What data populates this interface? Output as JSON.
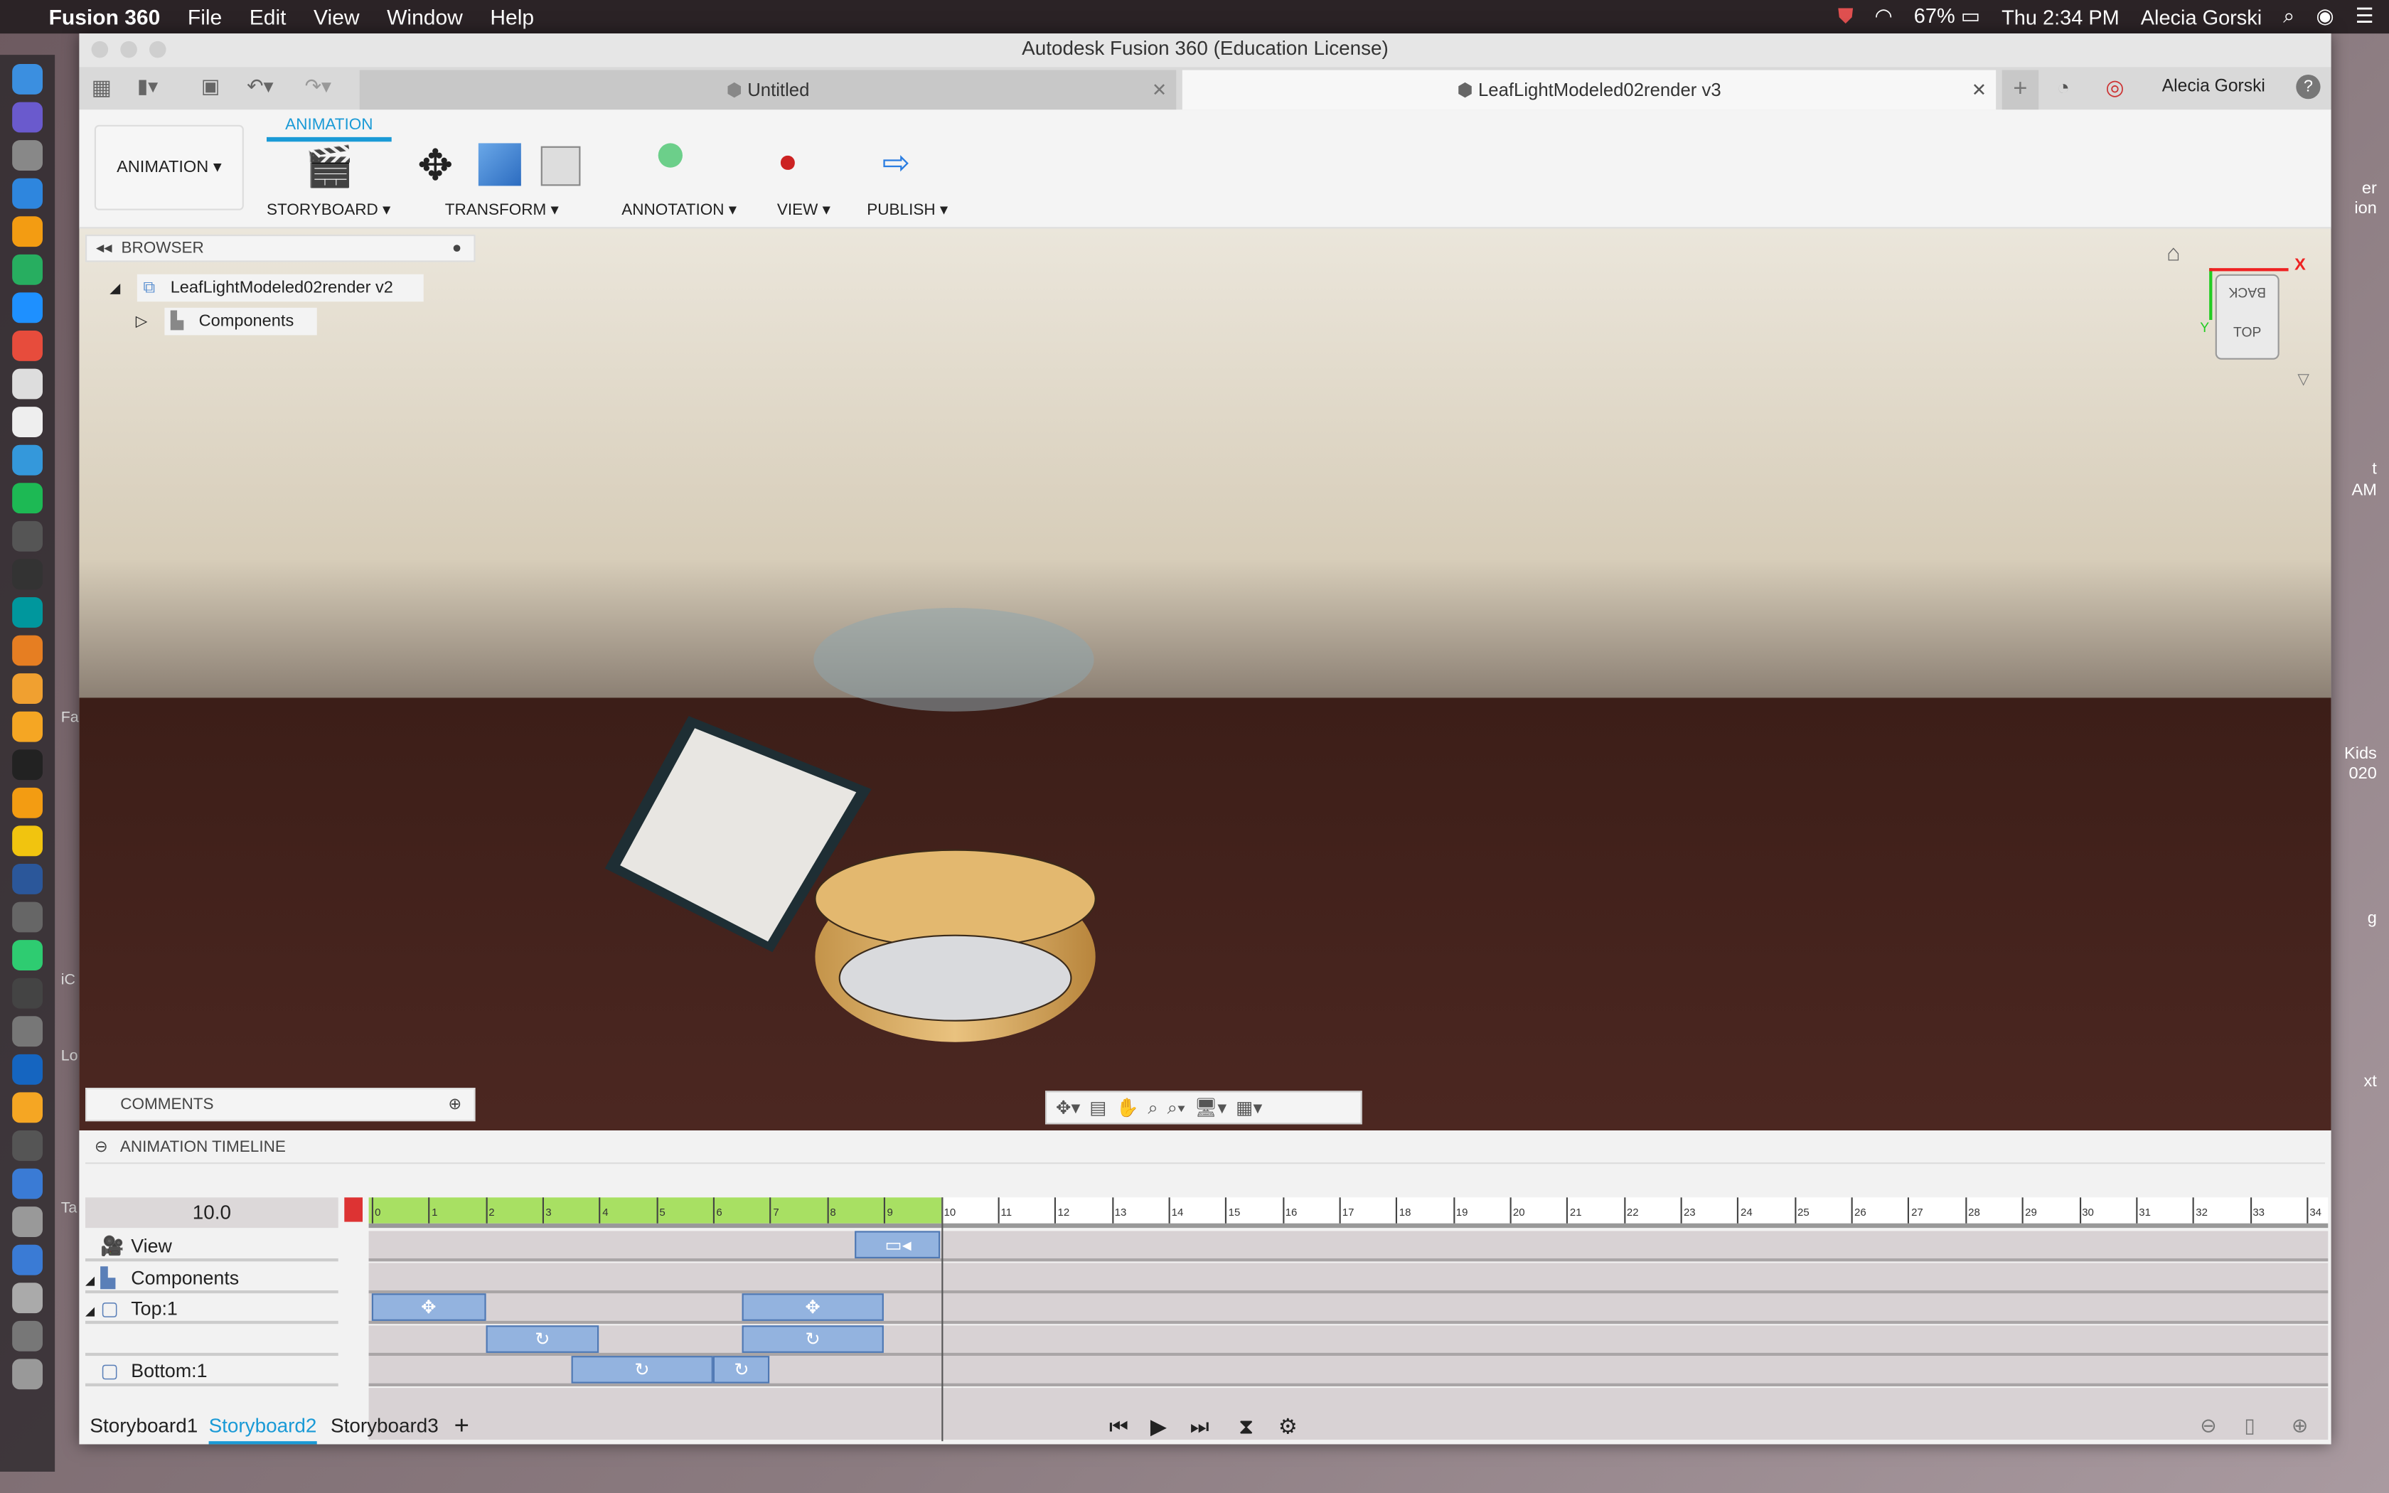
{
  "menubar": {
    "apple": "",
    "app": "Fusion 360",
    "items": [
      "File",
      "Edit",
      "View",
      "Window",
      "Help"
    ],
    "battery": "67%",
    "clock": "Thu 2:34 PM",
    "user": "Alecia Gorski"
  },
  "window": {
    "title": "Autodesk Fusion 360 (Education License)"
  },
  "tabs": [
    {
      "label": "Untitled",
      "active": false
    },
    {
      "label": "LeafLightModeled02render v3",
      "active": true
    }
  ],
  "account": {
    "user": "Alecia Gorski",
    "help": "?"
  },
  "ribbon": {
    "workspace": "ANIMATION",
    "active_tab": "ANIMATION",
    "groups": [
      "STORYBOARD",
      "TRANSFORM",
      "ANNOTATION",
      "VIEW",
      "PUBLISH"
    ]
  },
  "browser": {
    "title": "BROWSER",
    "root": "LeafLightModeled02render v2",
    "child": "Components"
  },
  "viewcube": {
    "face_top": "TOP",
    "face_back": "BACK",
    "axis_x": "X",
    "axis_y": "Y"
  },
  "comments": {
    "title": "COMMENTS"
  },
  "timeline": {
    "title": "ANIMATION TIMELINE",
    "current_time": "10.0",
    "ruler_max": 34,
    "playhead": 10,
    "accent": "#a8e063",
    "rows": [
      {
        "label": "View",
        "icon": "camera-icon",
        "expander": ""
      },
      {
        "label": "Components",
        "icon": "components-icon",
        "expander": "◢"
      },
      {
        "label": "Top:1",
        "icon": "component-icon",
        "expander": "◢"
      },
      {
        "label": "",
        "icon": "",
        "expander": ""
      },
      {
        "label": "Bottom:1",
        "icon": "component-icon",
        "expander": ""
      }
    ],
    "blocks": [
      {
        "row": 0,
        "start": 8.5,
        "end": 10,
        "icon": "camera-icon"
      },
      {
        "row": 2,
        "start": 0,
        "end": 2,
        "icon": "move-icon"
      },
      {
        "row": 2,
        "start": 6.5,
        "end": 9,
        "icon": "move-icon"
      },
      {
        "row": 3,
        "start": 2,
        "end": 4,
        "icon": "rotate-icon"
      },
      {
        "row": 3,
        "start": 6.5,
        "end": 9,
        "icon": "rotate-icon"
      },
      {
        "row": 4,
        "start": 3.5,
        "end": 6,
        "icon": "rotate-icon"
      },
      {
        "row": 4,
        "start": 6,
        "end": 7,
        "icon": "rotate-icon"
      }
    ]
  },
  "storyboards": [
    {
      "label": "Storyboard1",
      "active": false
    },
    {
      "label": "Storyboard2",
      "active": true
    },
    {
      "label": "Storyboard3",
      "active": false
    }
  ],
  "add_storyboard": "+",
  "desktop_fragments": [
    "er",
    "ion",
    "t",
    "AM",
    "Kids",
    "020",
    "g",
    "xt",
    "Fa",
    "iC",
    "Lo",
    "Ta"
  ]
}
